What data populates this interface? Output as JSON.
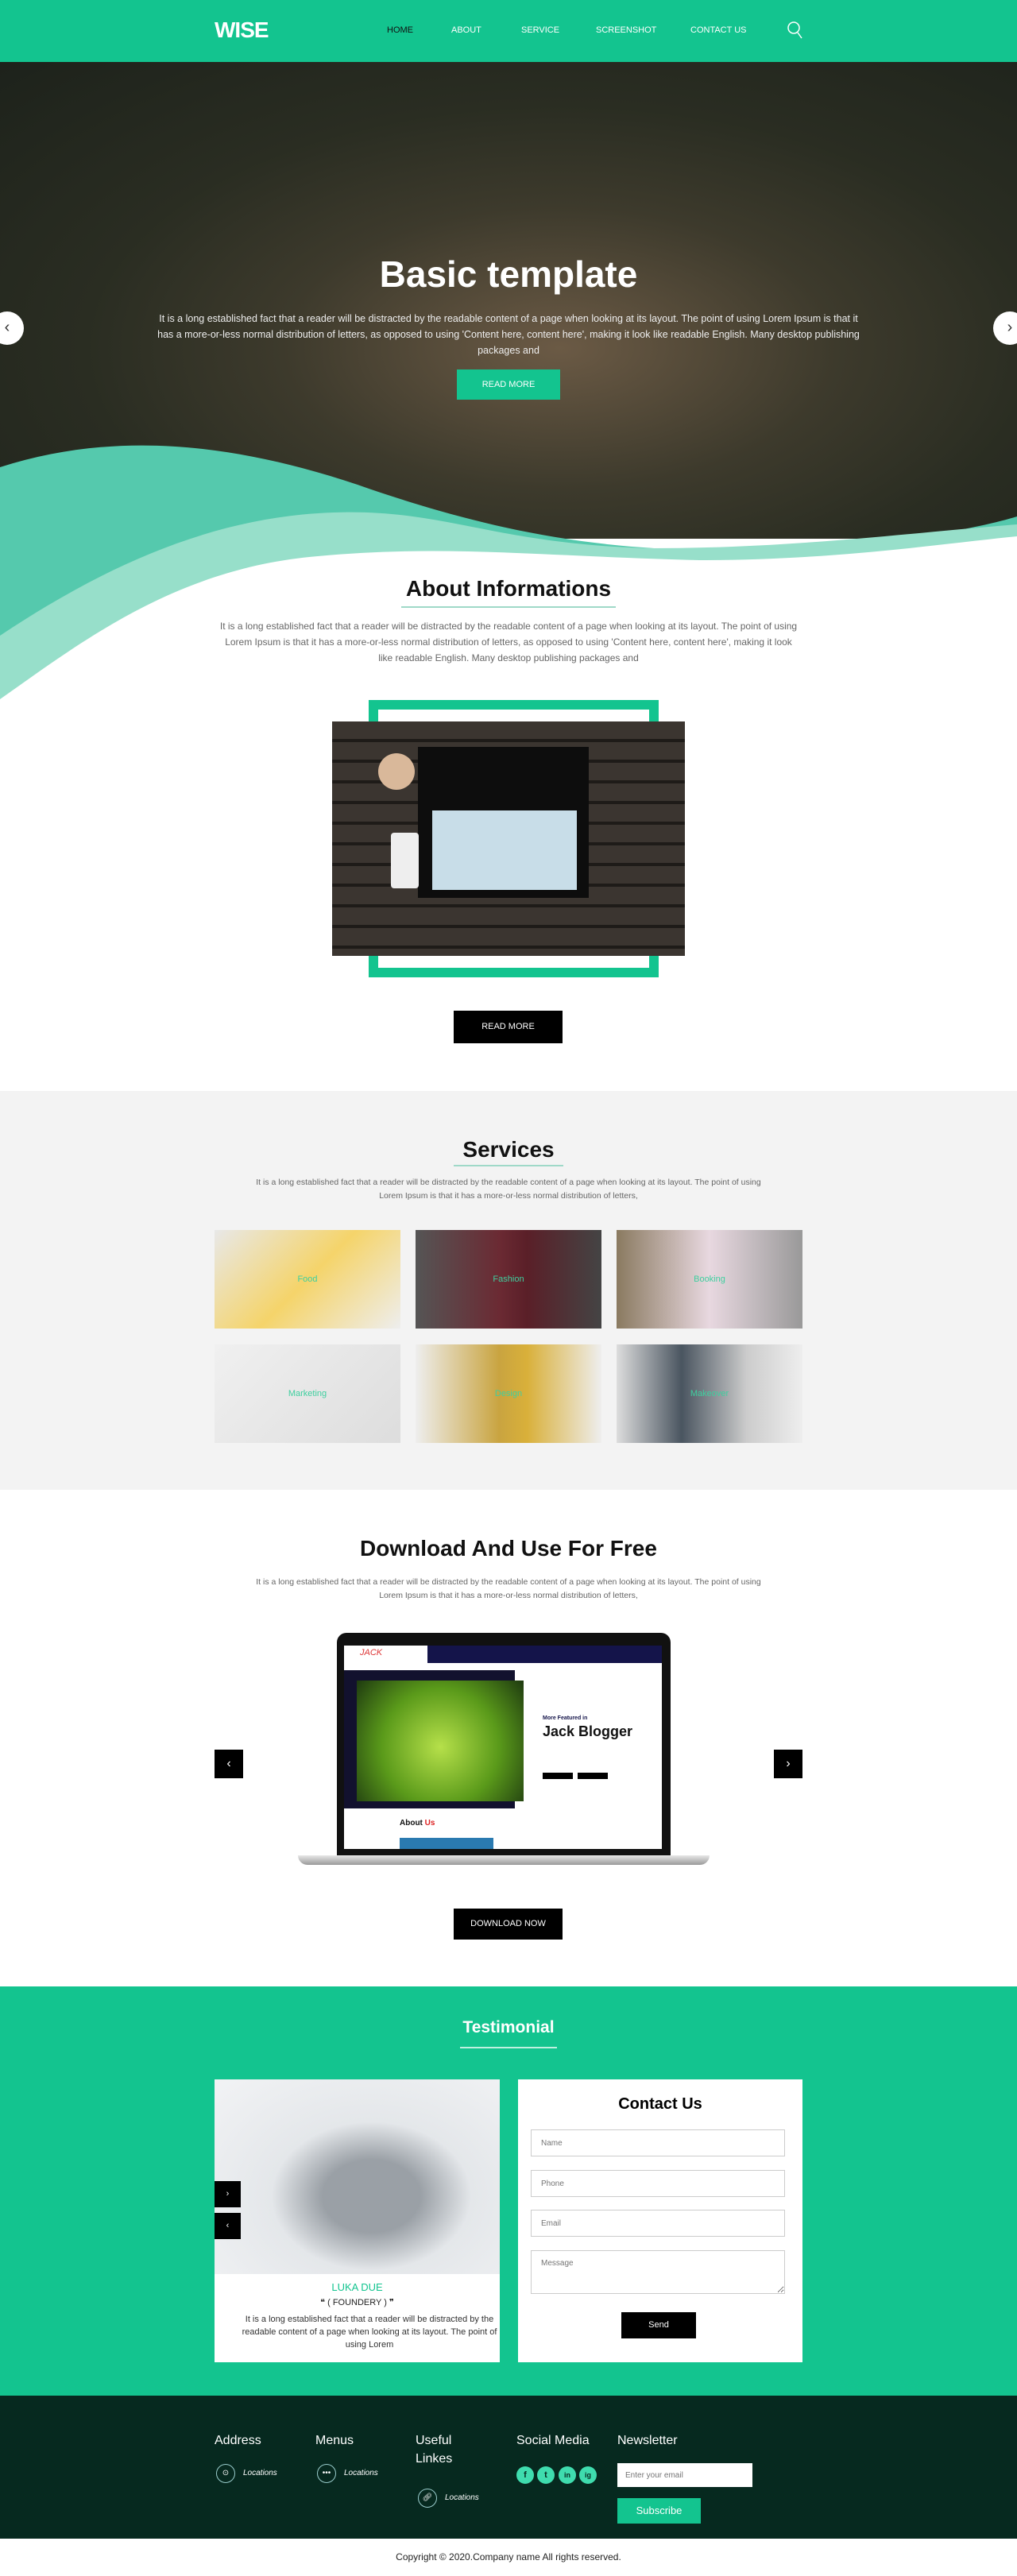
{
  "colors": {
    "accent": "#13c48f",
    "footer_bg": "#06291f",
    "services_bg": "#f3f3f3"
  },
  "nav": {
    "logo": "WISE",
    "items": [
      {
        "label": "HOME",
        "active": true
      },
      {
        "label": "ABOUT"
      },
      {
        "label": "SERVICE"
      },
      {
        "label": "SCREENSHOT"
      },
      {
        "label": "CONTACT US"
      }
    ],
    "search_icon": "search-icon"
  },
  "hero": {
    "title": "Basic template",
    "text": "It is a long established fact that a reader will be distracted by the readable content of a page when looking at its layout. The point of using Lorem Ipsum is that it has a more-or-less normal distribution of letters, as opposed to using 'Content here, content here', making it look like readable English. Many desktop publishing packages and",
    "button": "READ MORE",
    "prev": "‹",
    "next": "›"
  },
  "about": {
    "title": "About Informations",
    "text": "It is a long established fact that a reader will be distracted by the readable content of a page when looking at its layout. The point of using Lorem Ipsum is that it has a more-or-less normal distribution of letters, as opposed to using 'Content here, content here', making it look like readable English. Many desktop publishing packages and",
    "button": "READ MORE"
  },
  "services": {
    "title": "Services",
    "text": "It is a long established fact that a reader will be distracted by the readable content of a page when looking at its layout. The point of using Lorem Ipsum is that it has a more-or-less normal distribution of letters,",
    "items": [
      {
        "label": "Food"
      },
      {
        "label": "Fashion"
      },
      {
        "label": "Booking"
      },
      {
        "label": "Marketing"
      },
      {
        "label": "Design"
      },
      {
        "label": "Makeover"
      }
    ]
  },
  "download": {
    "title": "Download And Use For Free",
    "text": "It is a long established fact that a reader will be distracted by the readable content of a page when looking at its layout. The point of using Lorem Ipsum is that it has a more-or-less normal distribution of letters,",
    "button": "DOWNLOAD NOW",
    "screen": {
      "logo": "JACK",
      "featured": "More Featured in",
      "heading": "Jack Blogger",
      "about": "About",
      "about_accent": "Us"
    }
  },
  "testimonial": {
    "title": "Testimonial",
    "name": "LUKA DUE",
    "role": "( FOUNDERY )",
    "text": "It is a long established fact that a reader will be distracted by the readable content of a page when looking at its layout. The point of using Lorem"
  },
  "contact": {
    "title": "Contact Us",
    "name_placeholder": "Name",
    "phone_placeholder": "Phone",
    "email_placeholder": "Email",
    "message_placeholder": "Message",
    "send": "Send"
  },
  "footer": {
    "address": {
      "title": "Address",
      "item": "Locations"
    },
    "menus": {
      "title": "Menus",
      "item": "Locations"
    },
    "useful": {
      "title": "Useful Linkes",
      "item": "Locations"
    },
    "social": {
      "title": "Social Media",
      "icons": [
        "f",
        "t",
        "in",
        "ig"
      ]
    },
    "newsletter": {
      "title": "Newsletter",
      "placeholder": "Enter your email",
      "button": "Subscribe"
    },
    "copyright": "Copyright © 2020.Company name All rights reserved."
  }
}
